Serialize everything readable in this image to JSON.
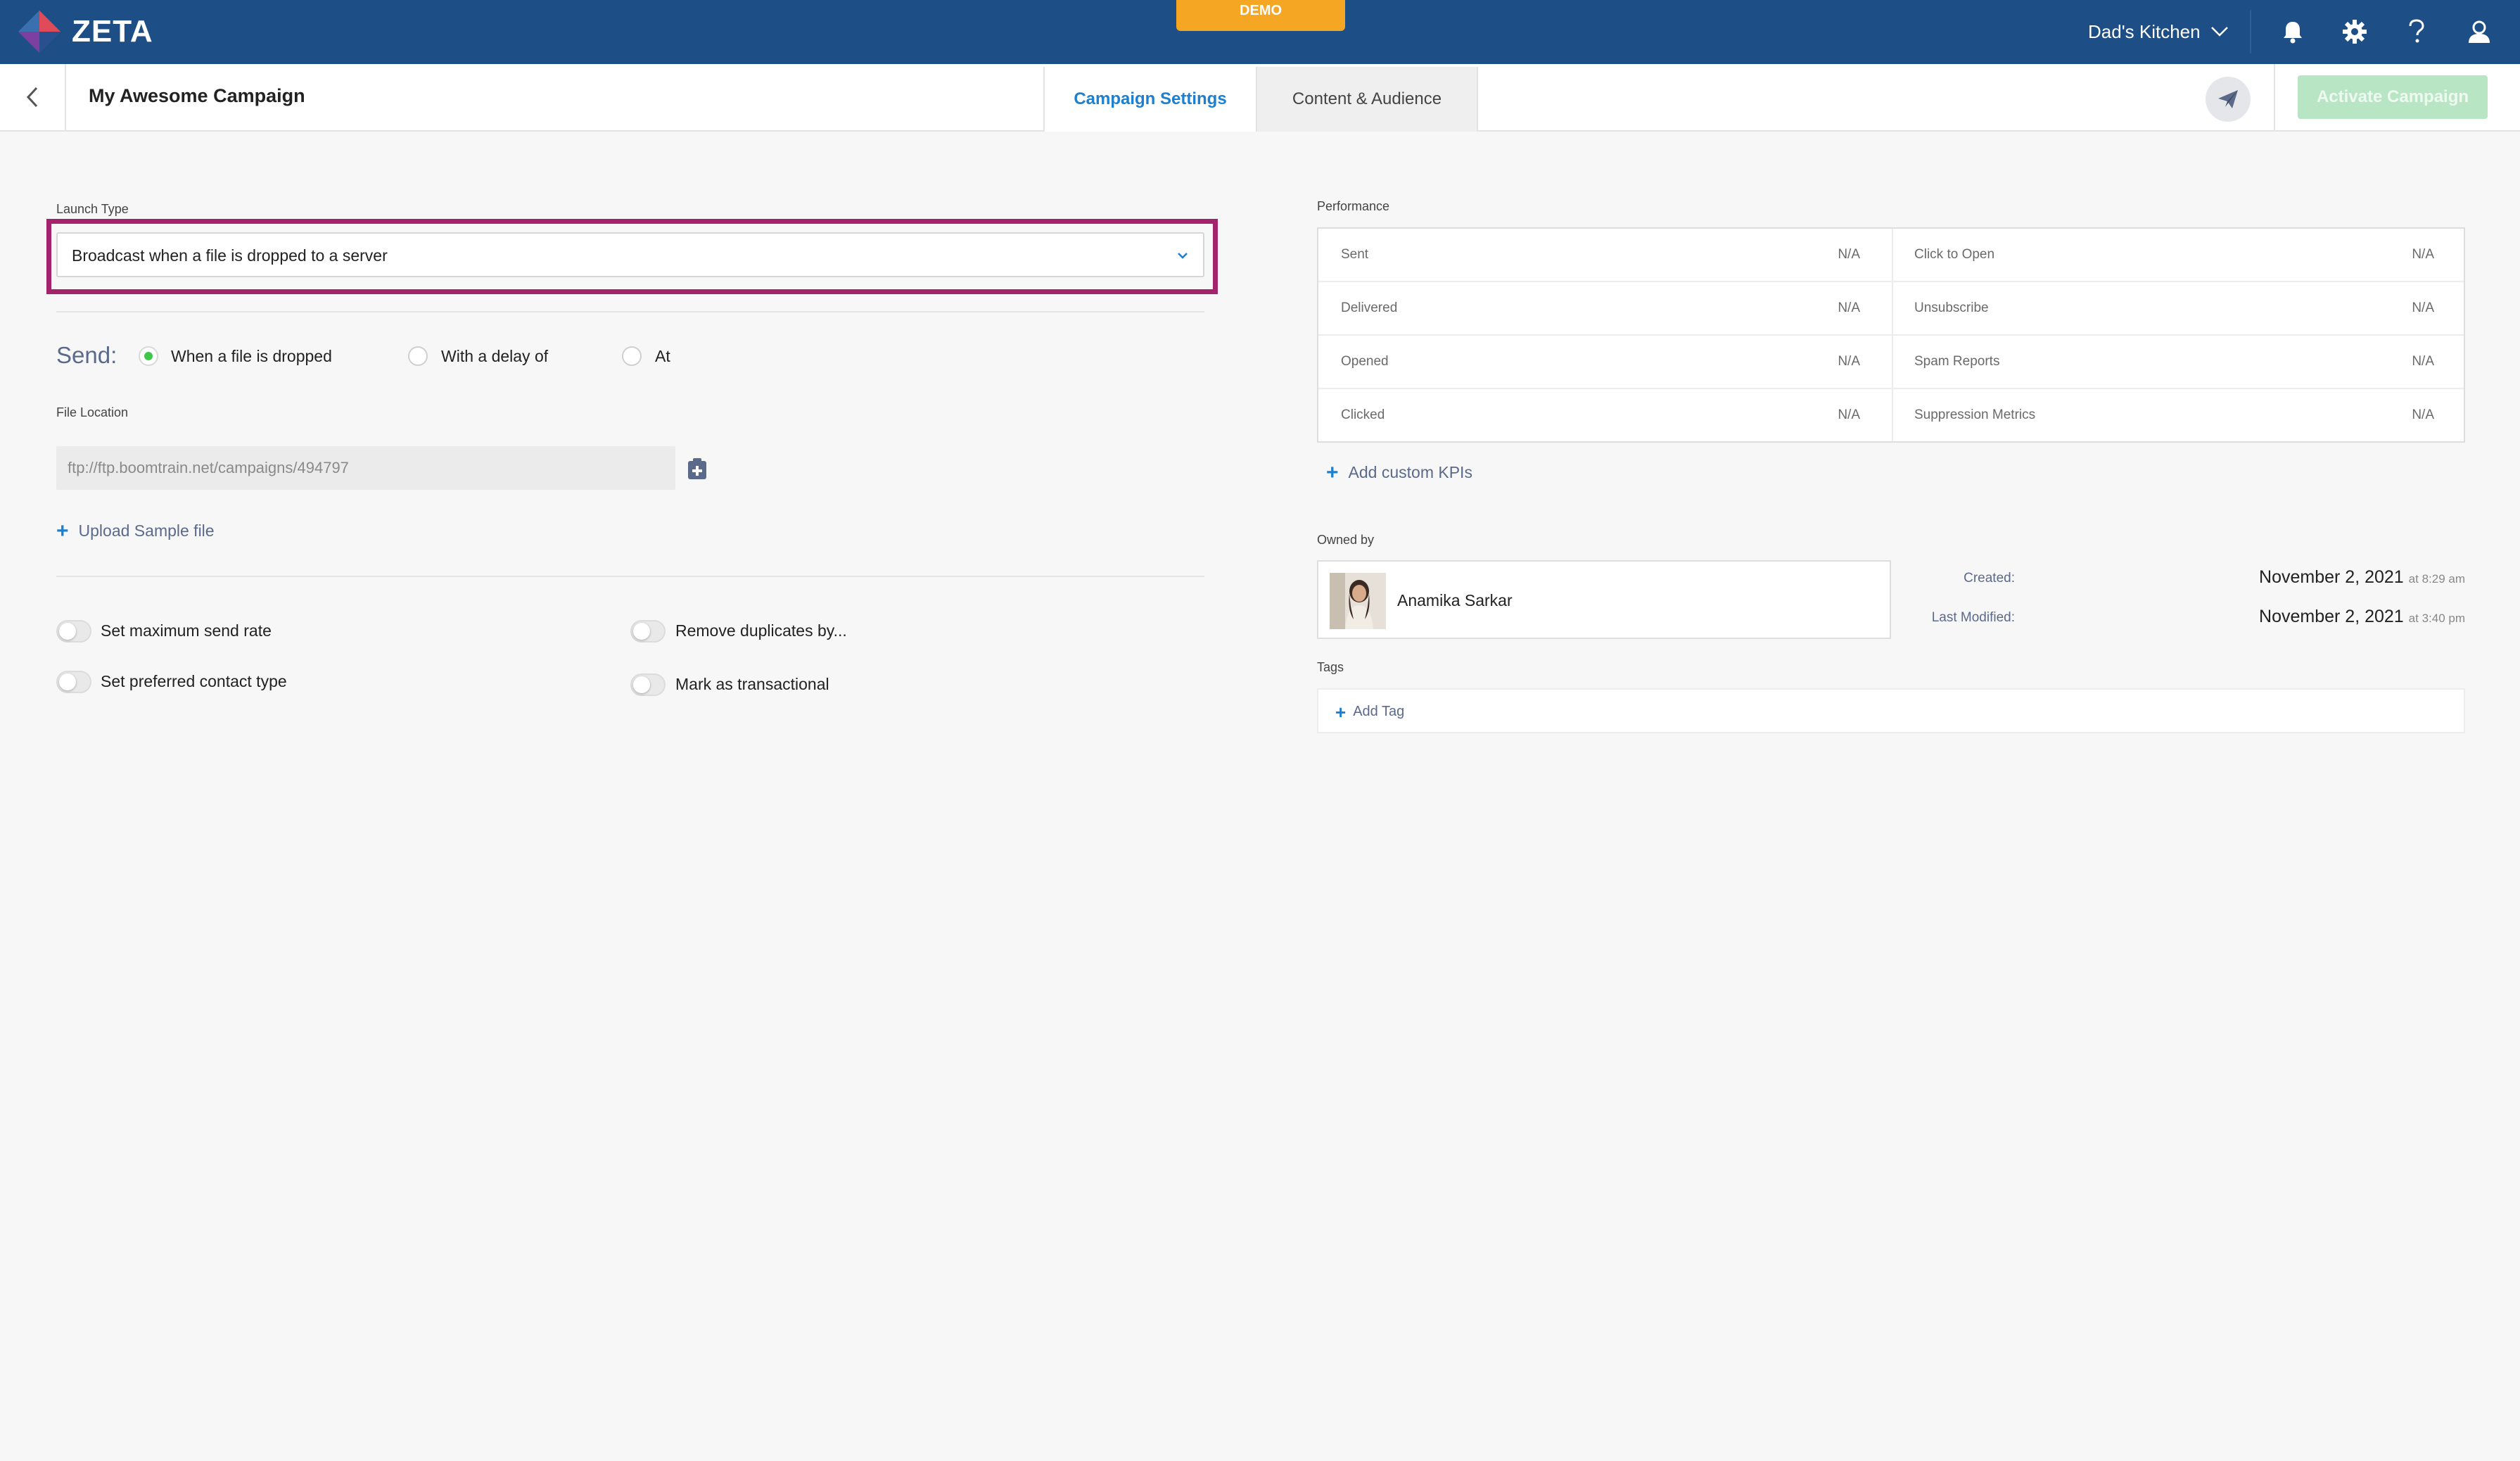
{
  "topbar": {
    "brand": "ZETA",
    "demo_badge": "DEMO",
    "account_name": "Dad's Kitchen",
    "brand_color": "#1d4e85"
  },
  "subheader": {
    "campaign_title": "My Awesome Campaign",
    "tabs": [
      {
        "label": "Campaign Settings",
        "active": true
      },
      {
        "label": "Content & Audience",
        "active": false
      }
    ],
    "activate_label": "Activate Campaign"
  },
  "left": {
    "launch_type_label": "Launch Type",
    "launch_type_value": "Broadcast when a file is dropped to a server",
    "send_label": "Send:",
    "send_options": [
      {
        "label": "When a file is dropped",
        "selected": true
      },
      {
        "label": "With a delay of",
        "selected": false
      },
      {
        "label": "At",
        "selected": false
      }
    ],
    "file_location_label": "File Location",
    "file_location_placeholder": "ftp://ftp.boomtrain.net/campaigns/494797",
    "upload_label": "Upload Sample file",
    "toggles": [
      {
        "label": "Set maximum send rate",
        "on": false
      },
      {
        "label": "Remove duplicates by...",
        "on": false
      },
      {
        "label": "Set preferred contact type",
        "on": false
      },
      {
        "label": "Mark as transactional",
        "on": false
      }
    ]
  },
  "right": {
    "performance_label": "Performance",
    "performance": [
      {
        "name": "Sent",
        "value": "N/A"
      },
      {
        "name": "Click to Open",
        "value": "N/A"
      },
      {
        "name": "Delivered",
        "value": "N/A"
      },
      {
        "name": "Unsubscribe",
        "value": "N/A"
      },
      {
        "name": "Opened",
        "value": "N/A"
      },
      {
        "name": "Spam Reports",
        "value": "N/A"
      },
      {
        "name": "Clicked",
        "value": "N/A"
      },
      {
        "name": "Suppression Metrics",
        "value": "N/A"
      }
    ],
    "add_kpi_label": "Add custom KPIs",
    "owned_by_label": "Owned by",
    "owner_name": "Anamika Sarkar",
    "created_label": "Created:",
    "created_date": "November 2, 2021",
    "created_time": "at 8:29 am",
    "modified_label": "Last Modified:",
    "modified_date": "November 2, 2021",
    "modified_time": "at 3:40 pm",
    "tags_label": "Tags",
    "add_tag_label": "Add Tag"
  },
  "colors": {
    "accent": "#1c7fcf",
    "highlight": "#a3236c",
    "radio_on": "#3ec748",
    "demo": "#f5a623",
    "activate": "#b8e6c4"
  },
  "icons": [
    "zeta-logo-icon",
    "chevron-down-icon",
    "bell-icon",
    "gear-icon",
    "help-icon",
    "user-icon",
    "back-arrow-icon",
    "paper-plane-icon",
    "clipboard-icon",
    "plus-icon"
  ]
}
